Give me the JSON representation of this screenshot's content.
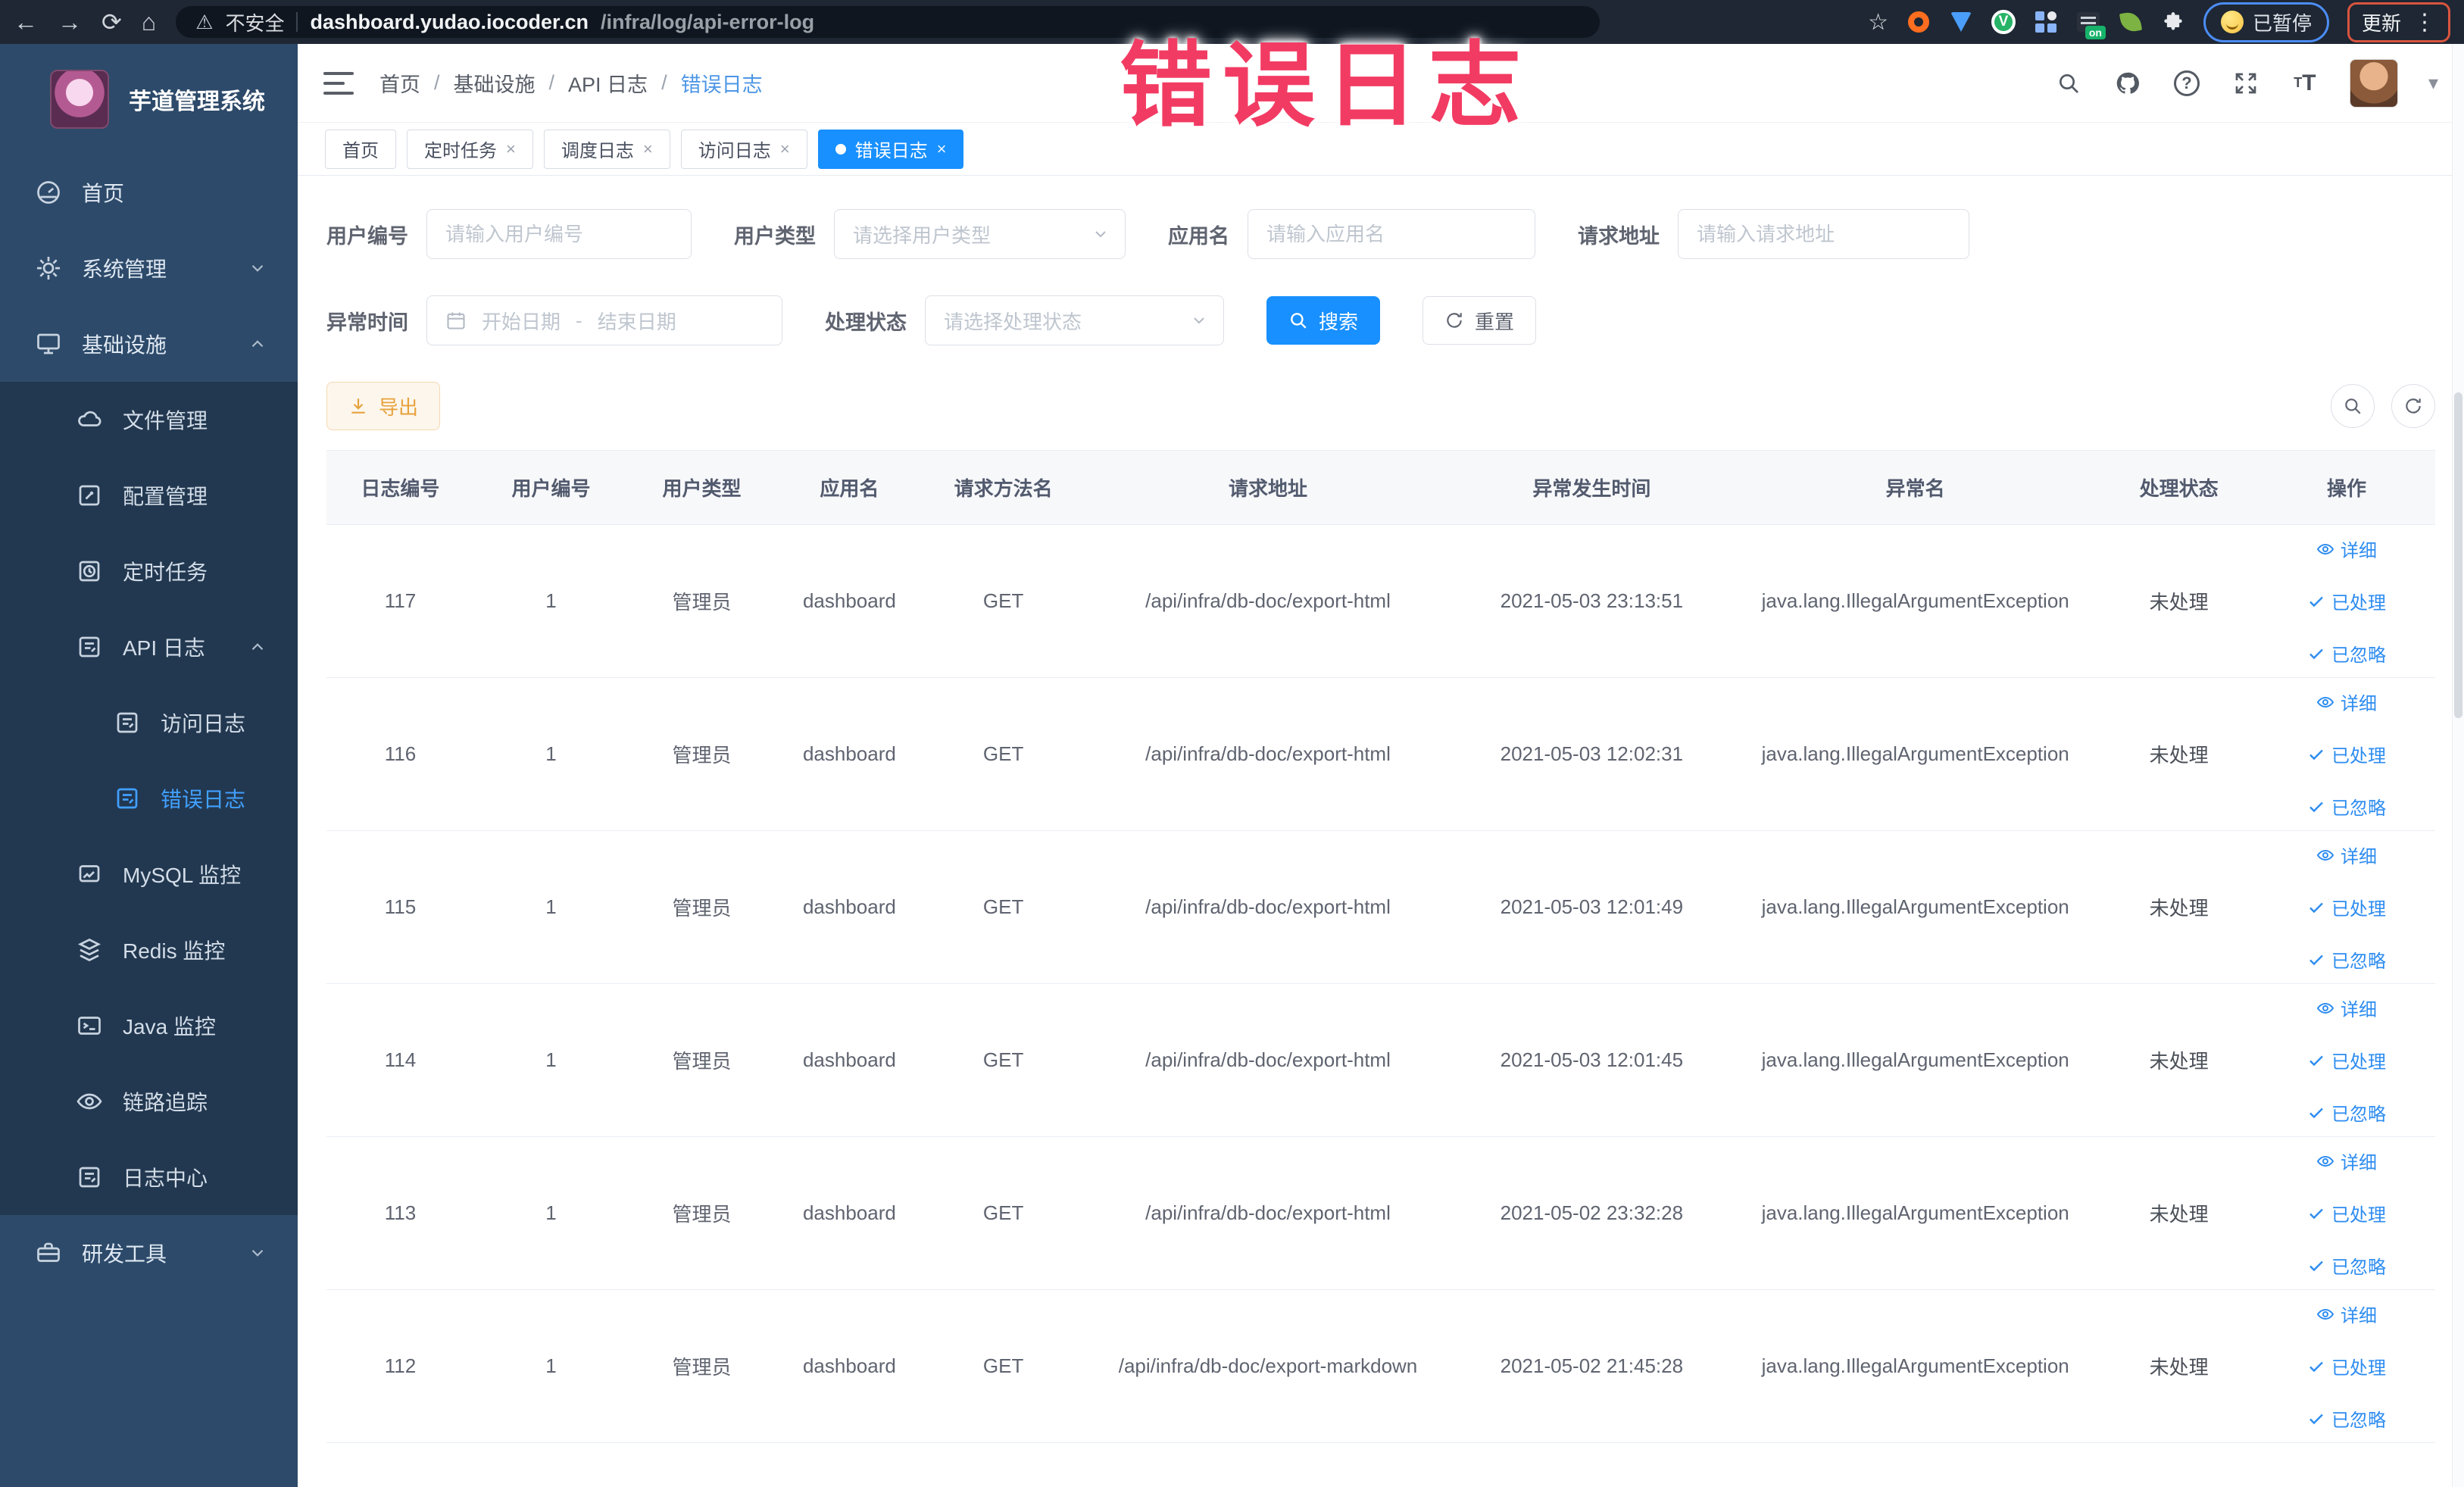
{
  "colors": {
    "accent": "#1890ff",
    "sidebar_bg": "#2d4a6a",
    "submenu_bg": "#223850",
    "active_link": "#41a0ff",
    "warning": "#e6a23c",
    "annotation": "#f23b63",
    "chrome_bg": "#1e2733"
  },
  "browser": {
    "security_label": "不安全",
    "url_host": "dashboard.yudao.iocoder.cn",
    "url_path": "/infra/log/api-error-log",
    "paused_badge": "已暂停",
    "update_button": "更新"
  },
  "annotation": {
    "text": "错误日志"
  },
  "sidebar": {
    "app_title": "芋道管理系统",
    "items": [
      {
        "label": "首页"
      },
      {
        "label": "系统管理"
      },
      {
        "label": "基础设施"
      },
      {
        "label": "文件管理"
      },
      {
        "label": "配置管理"
      },
      {
        "label": "定时任务"
      },
      {
        "label": "API 日志"
      },
      {
        "label": "访问日志"
      },
      {
        "label": "错误日志"
      },
      {
        "label": "MySQL 监控"
      },
      {
        "label": "Redis 监控"
      },
      {
        "label": "Java 监控"
      },
      {
        "label": "链路追踪"
      },
      {
        "label": "日志中心"
      },
      {
        "label": "研发工具"
      }
    ]
  },
  "breadcrumb": {
    "items": [
      "首页",
      "基础设施",
      "API 日志",
      "错误日志"
    ],
    "separator": "/"
  },
  "tabs": [
    {
      "label": "首页"
    },
    {
      "label": "定时任务"
    },
    {
      "label": "调度日志"
    },
    {
      "label": "访问日志"
    },
    {
      "label": "错误日志"
    }
  ],
  "filters": {
    "user_id": {
      "label": "用户编号",
      "placeholder": "请输入用户编号"
    },
    "user_type": {
      "label": "用户类型",
      "placeholder": "请选择用户类型"
    },
    "app_name": {
      "label": "应用名",
      "placeholder": "请输入应用名"
    },
    "request_url": {
      "label": "请求地址",
      "placeholder": "请输入请求地址"
    },
    "exception_time": {
      "label": "异常时间",
      "start_placeholder": "开始日期",
      "separator": "-",
      "end_placeholder": "结束日期"
    },
    "process_status": {
      "label": "处理状态",
      "placeholder": "请选择处理状态"
    },
    "search_button": "搜索",
    "reset_button": "重置"
  },
  "toolbar": {
    "export_button": "导出"
  },
  "table": {
    "columns": [
      "日志编号",
      "用户编号",
      "用户类型",
      "应用名",
      "请求方法名",
      "请求地址",
      "异常发生时间",
      "异常名",
      "处理状态",
      "操作"
    ],
    "action_labels": {
      "detail": "详细",
      "processed": "已处理",
      "ignored": "已忽略"
    },
    "rows": [
      {
        "log_id": "117",
        "user_id": "1",
        "user_type": "管理员",
        "app_name": "dashboard",
        "method": "GET",
        "url": "/api/infra/db-doc/export-html",
        "time": "2021-05-03 23:13:51",
        "exception": "java.lang.IllegalArgumentException",
        "status": "未处理"
      },
      {
        "log_id": "116",
        "user_id": "1",
        "user_type": "管理员",
        "app_name": "dashboard",
        "method": "GET",
        "url": "/api/infra/db-doc/export-html",
        "time": "2021-05-03 12:02:31",
        "exception": "java.lang.IllegalArgumentException",
        "status": "未处理"
      },
      {
        "log_id": "115",
        "user_id": "1",
        "user_type": "管理员",
        "app_name": "dashboard",
        "method": "GET",
        "url": "/api/infra/db-doc/export-html",
        "time": "2021-05-03 12:01:49",
        "exception": "java.lang.IllegalArgumentException",
        "status": "未处理"
      },
      {
        "log_id": "114",
        "user_id": "1",
        "user_type": "管理员",
        "app_name": "dashboard",
        "method": "GET",
        "url": "/api/infra/db-doc/export-html",
        "time": "2021-05-03 12:01:45",
        "exception": "java.lang.IllegalArgumentException",
        "status": "未处理"
      },
      {
        "log_id": "113",
        "user_id": "1",
        "user_type": "管理员",
        "app_name": "dashboard",
        "method": "GET",
        "url": "/api/infra/db-doc/export-html",
        "time": "2021-05-02 23:32:28",
        "exception": "java.lang.IllegalArgumentException",
        "status": "未处理"
      },
      {
        "log_id": "112",
        "user_id": "1",
        "user_type": "管理员",
        "app_name": "dashboard",
        "method": "GET",
        "url": "/api/infra/db-doc/export-markdown",
        "time": "2021-05-02 21:45:28",
        "exception": "java.lang.IllegalArgumentException",
        "status": "未处理"
      }
    ]
  }
}
